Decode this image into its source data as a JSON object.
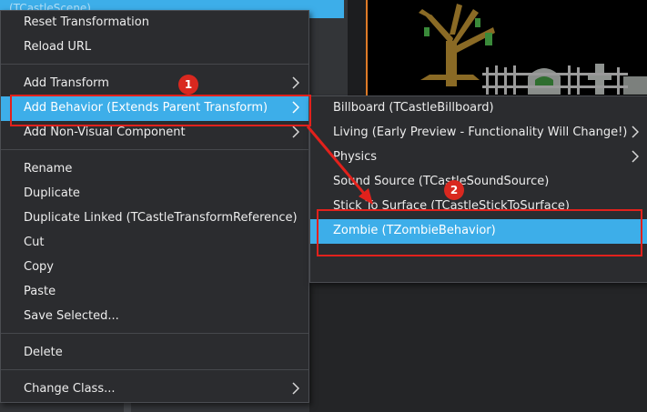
{
  "tree": {
    "selected_item": "(TCastleScene)"
  },
  "context_menu": {
    "items": [
      {
        "label": "Reset Transformation"
      },
      {
        "label": "Reload URL"
      },
      {
        "label": "Add Transform"
      },
      {
        "label": "Add Behavior (Extends Parent Transform)"
      },
      {
        "label": "Add Non-Visual Component"
      },
      {
        "label": "Rename"
      },
      {
        "label": "Duplicate"
      },
      {
        "label": "Duplicate Linked (TCastleTransformReference)"
      },
      {
        "label": "Cut"
      },
      {
        "label": "Copy"
      },
      {
        "label": "Paste"
      },
      {
        "label": "Save Selected..."
      },
      {
        "label": "Delete"
      },
      {
        "label": "Change Class..."
      }
    ]
  },
  "submenu": {
    "items": [
      {
        "label": "Billboard (TCastleBillboard)"
      },
      {
        "label": "Living (Early Preview - Functionality Will Change!)"
      },
      {
        "label": "Physics"
      },
      {
        "label": "Sound Source (TCastleSoundSource)"
      },
      {
        "label": "Stick To Surface (TCastleStickToSurface)"
      },
      {
        "label": "Zombie (TZombieBehavior)"
      }
    ]
  },
  "annotations": {
    "badge_1": "1",
    "badge_2": "2"
  },
  "colors": {
    "highlight": "#3daee9",
    "annotation_red": "#e2211c",
    "menu_bg": "#2b2c2f"
  },
  "icons": [
    "chevron-right-icon",
    "arrow-annotation"
  ]
}
